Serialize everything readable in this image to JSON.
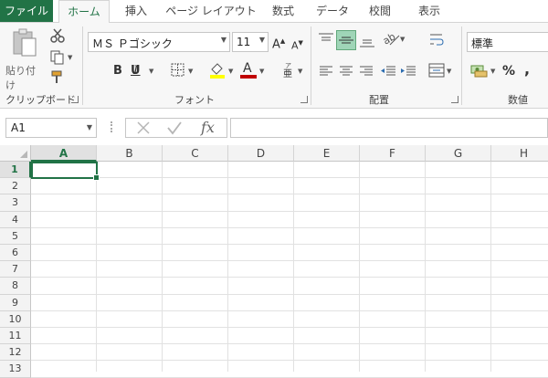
{
  "tabs": [
    "ファイル",
    "ホーム",
    "挿入",
    "ページ レイアウト",
    "数式",
    "データ",
    "校閲",
    "表示"
  ],
  "clipboard": {
    "paste_label": "貼り付け",
    "group_label": "クリップボード"
  },
  "font": {
    "name": "ＭＳ Ｐゴシック",
    "size": "11",
    "group_label": "フォント",
    "bold": "B",
    "italic": "I",
    "underline": "U",
    "color_letter": "A",
    "highlight_color": "#ffff00",
    "font_color": "#c00000"
  },
  "alignment": {
    "group_label": "配置"
  },
  "number": {
    "format": "標準",
    "group_label": "数値",
    "percent": "%",
    "comma": ","
  },
  "formula_bar": {
    "name_box": "A1",
    "fx": "fx",
    "value": ""
  },
  "columns": [
    "A",
    "B",
    "C",
    "D",
    "E",
    "F",
    "G",
    "H"
  ],
  "rows": [
    "1",
    "2",
    "3",
    "4",
    "5",
    "6",
    "7",
    "8",
    "9",
    "10",
    "11",
    "12",
    "13"
  ],
  "selected_cell": "A1",
  "colors": {
    "accent": "#217346",
    "file_tab": "#217346"
  }
}
